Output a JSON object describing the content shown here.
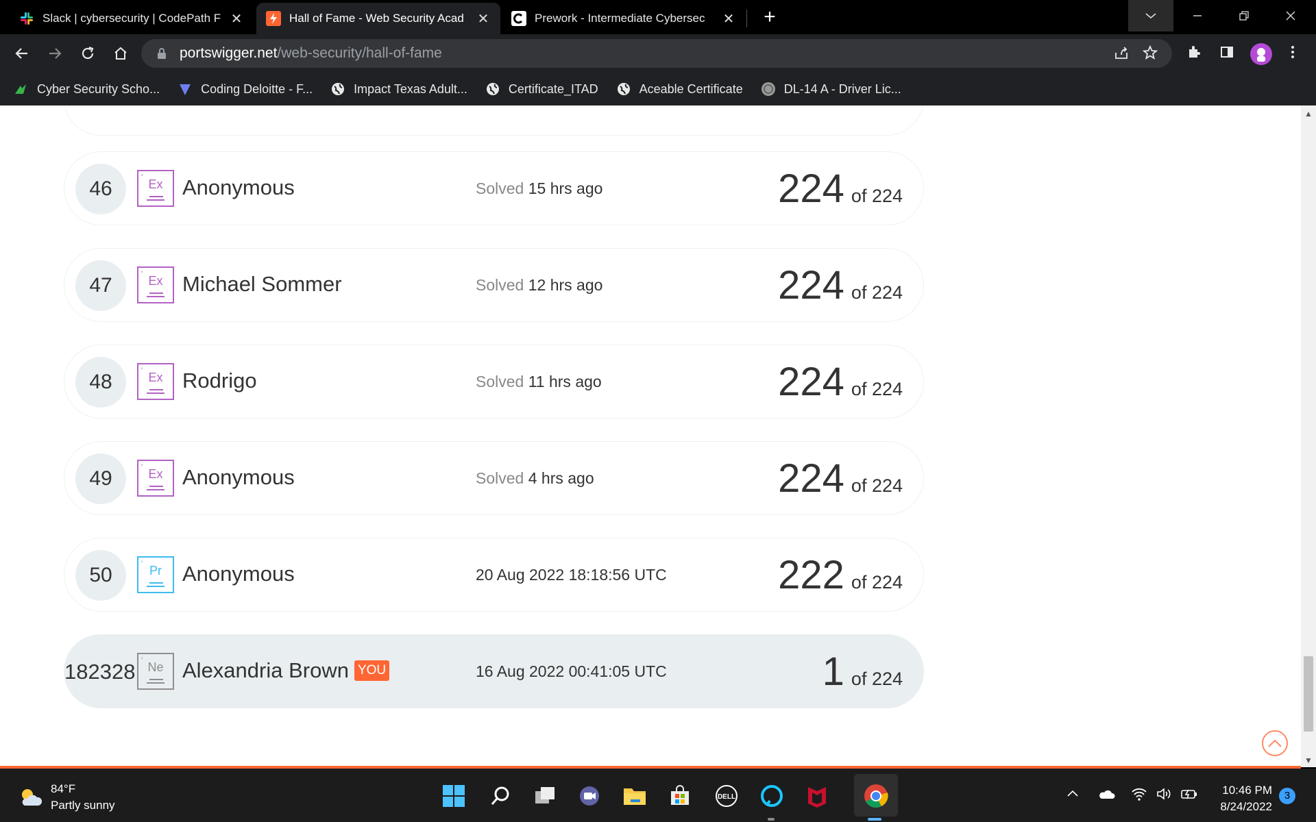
{
  "browser": {
    "tabs": [
      {
        "title": "Slack | cybersecurity | CodePath F",
        "active": false
      },
      {
        "title": "Hall of Fame - Web Security Acad",
        "active": true
      },
      {
        "title": "Prework - Intermediate Cybersec",
        "active": false
      }
    ],
    "close_glyph": "✕",
    "new_tab_glyph": "+",
    "url_host": "portswigger.net",
    "url_path": "/web-security/hall-of-fame",
    "bookmarks": [
      {
        "label": "Cyber Security Scho...",
        "icon": "bookmark-leaf-icon"
      },
      {
        "label": "Coding Deloitte - F...",
        "icon": "bookmark-heart-icon"
      },
      {
        "label": "Impact Texas Adult...",
        "icon": "globe-icon"
      },
      {
        "label": "Certificate_ITAD",
        "icon": "globe-icon"
      },
      {
        "label": "Aceable Certificate",
        "icon": "globe-icon"
      },
      {
        "label": "DL-14 A - Driver Lic...",
        "icon": "seal-icon"
      }
    ]
  },
  "leaderboard": {
    "solved_label": "Solved",
    "of_total": "of 224",
    "you_tag": "YOU",
    "rows": [
      {
        "rank": "46",
        "badge": "Ex",
        "badge_type": "expert",
        "name": "Anonymous",
        "solved_time": "15 hrs ago",
        "score": "224"
      },
      {
        "rank": "47",
        "badge": "Ex",
        "badge_type": "expert",
        "name": "Michael Sommer",
        "solved_time": "12 hrs ago",
        "score": "224"
      },
      {
        "rank": "48",
        "badge": "Ex",
        "badge_type": "expert",
        "name": "Rodrigo",
        "solved_time": "11 hrs ago",
        "score": "224"
      },
      {
        "rank": "49",
        "badge": "Ex",
        "badge_type": "expert",
        "name": "Anonymous",
        "solved_time": "4 hrs ago",
        "score": "224"
      },
      {
        "rank": "50",
        "badge": "Pr",
        "badge_type": "practitioner",
        "name": "Anonymous",
        "date": "20 Aug 2022 18:18:56 UTC",
        "score": "222"
      },
      {
        "rank": "182328",
        "badge": "Ne",
        "badge_type": "newcomer",
        "name": "Alexandria Brown",
        "date": "16 Aug 2022 00:41:05 UTC",
        "score": "1",
        "is_you": true
      }
    ]
  },
  "taskbar": {
    "temperature": "84°F",
    "weather": "Partly sunny",
    "time": "10:46 PM",
    "date": "8/24/2022",
    "notifications": "3"
  },
  "colors": {
    "accent": "#ff6633",
    "expert": "#b361c4",
    "practitioner": "#3cbcee",
    "newcomer": "#8e8e8e"
  }
}
